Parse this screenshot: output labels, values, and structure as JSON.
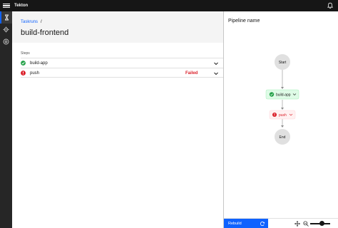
{
  "app": {
    "title": "Tekton"
  },
  "breadcrumb": {
    "link": "Taskruns",
    "separator": "/"
  },
  "page": {
    "title": "build-frontend"
  },
  "steps": {
    "label": "Steps",
    "items": [
      {
        "name": "build-app",
        "status": "",
        "icon": "checkmark-filled-icon"
      },
      {
        "name": "push",
        "status": "Failed",
        "icon": "error-filled-icon"
      }
    ]
  },
  "panel": {
    "title": "Pipeline name"
  },
  "pipeline": {
    "start_label": "Start",
    "end_label": "End",
    "nodes": [
      {
        "name": "build-app",
        "state": "success"
      },
      {
        "name": "push",
        "state": "failed"
      }
    ]
  },
  "toolbar": {
    "rebuild_label": "Rebuild"
  },
  "colors": {
    "success": "#24a148",
    "error": "#da1e28",
    "accent": "#0f62fe",
    "header_bg": "#161616",
    "sidenav_bg": "#262626"
  }
}
